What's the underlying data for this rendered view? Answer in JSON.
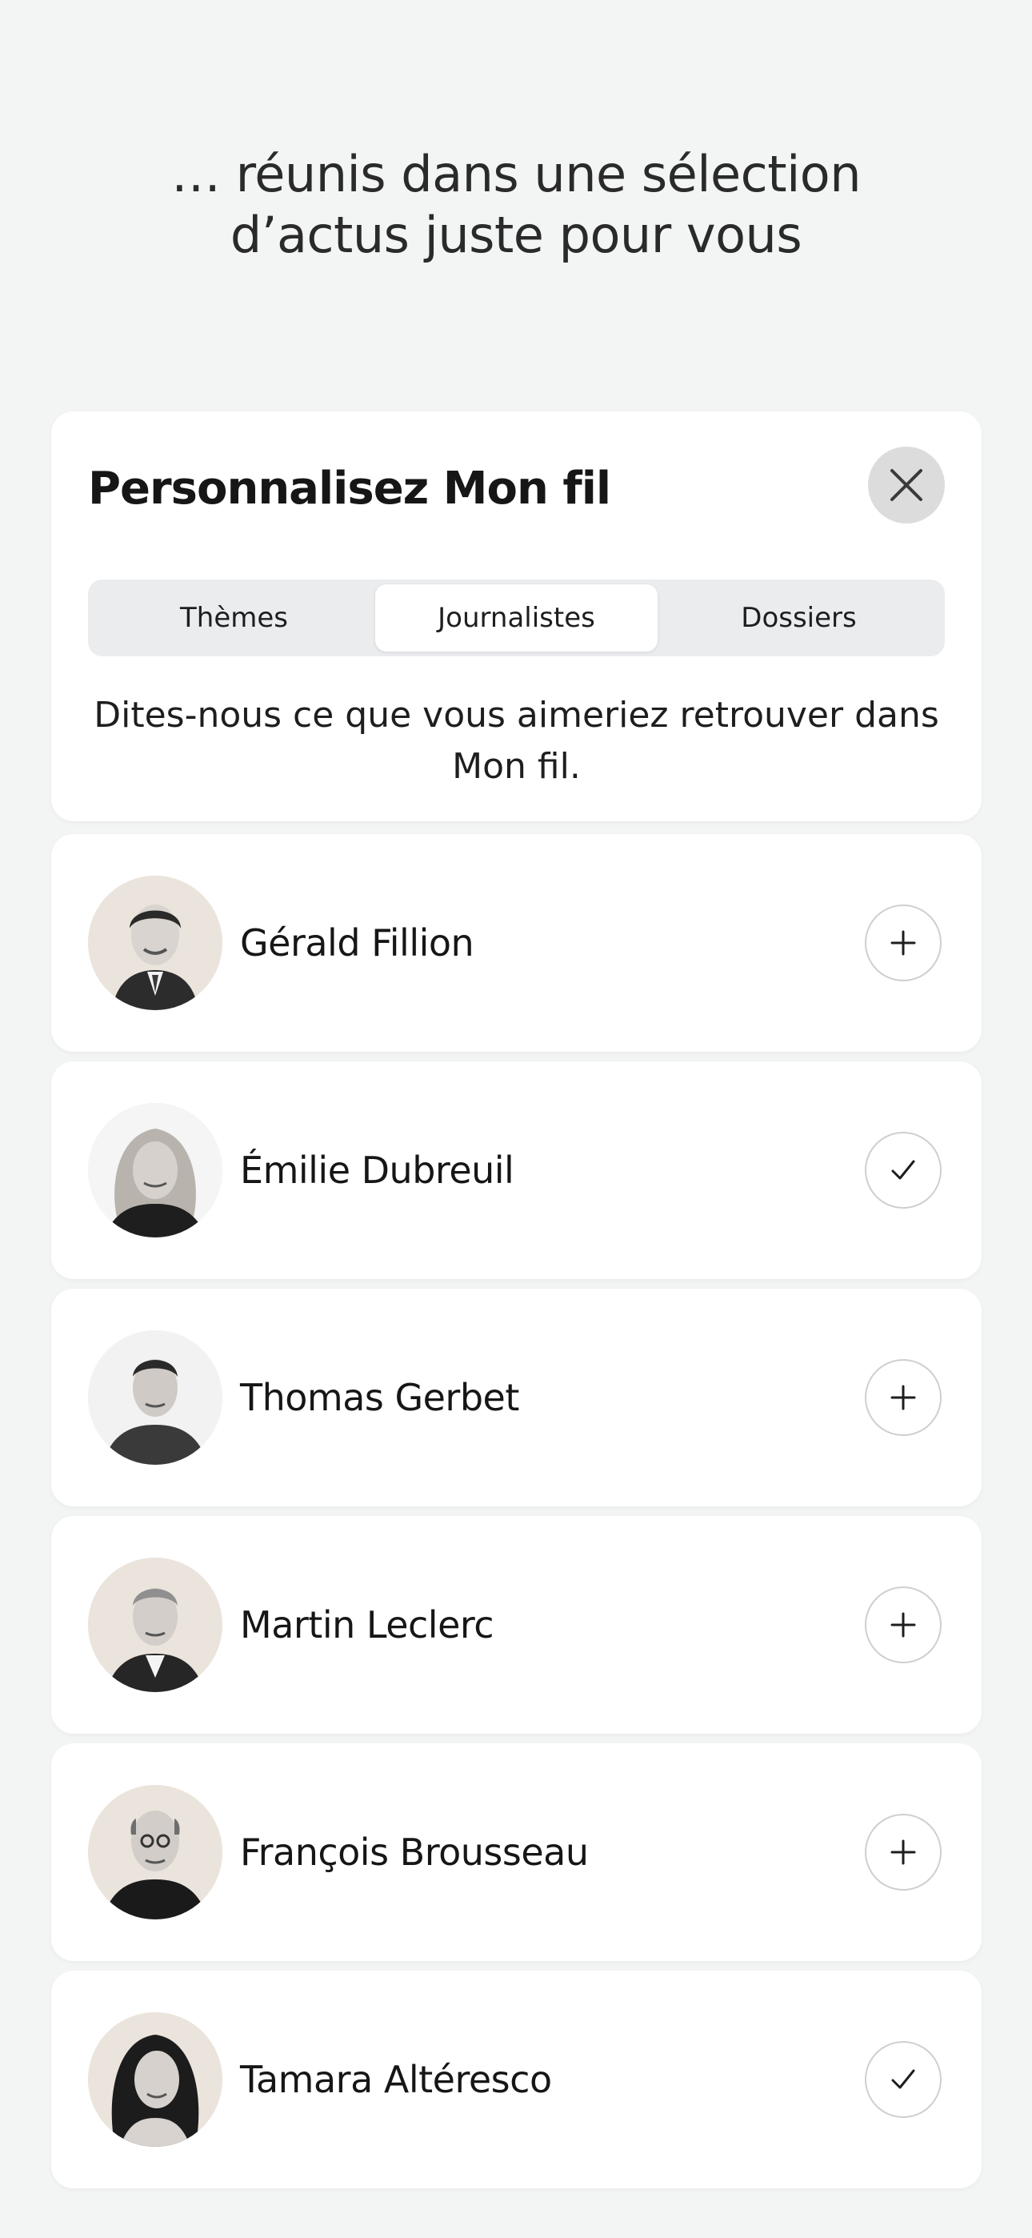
{
  "headline": {
    "line1": "… réunis dans une sélection",
    "line2": "d’actus juste pour vous"
  },
  "sheet": {
    "title": "Personnalisez Mon fil",
    "close_icon": "close-icon",
    "tabs": [
      {
        "label": "Thèmes",
        "active": false
      },
      {
        "label": "Journalistes",
        "active": true
      },
      {
        "label": "Dossiers",
        "active": false
      }
    ],
    "subtitle": "Dites-nous ce que vous aimeriez retrouver dans Mon fil."
  },
  "journalists": [
    {
      "name": "Gérald Fillion",
      "following": false,
      "action_icon": "plus-icon"
    },
    {
      "name": "Émilie Dubreuil",
      "following": true,
      "action_icon": "checkmark-icon"
    },
    {
      "name": "Thomas Gerbet",
      "following": false,
      "action_icon": "plus-icon"
    },
    {
      "name": "Martin Leclerc",
      "following": false,
      "action_icon": "plus-icon"
    },
    {
      "name": "François Brousseau",
      "following": false,
      "action_icon": "plus-icon"
    },
    {
      "name": "Tamara Altéresco",
      "following": true,
      "action_icon": "checkmark-icon"
    }
  ],
  "colors": {
    "background": "#f3f4f4",
    "card": "#ffffff",
    "segment_track": "#ebecee",
    "close_button": "#dcdcdc",
    "avatar_background": "#ebe6e0"
  }
}
